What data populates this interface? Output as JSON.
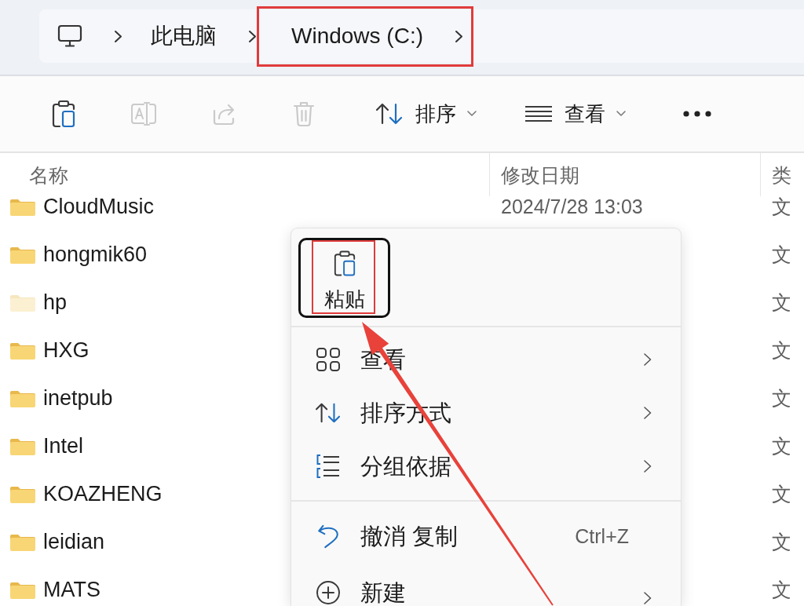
{
  "breadcrumb": {
    "items": [
      {
        "label": "此电脑",
        "highlighted": false
      },
      {
        "label": "Windows (C:)",
        "highlighted": true
      }
    ]
  },
  "toolbar": {
    "actions": [
      {
        "kind": "paste",
        "disabled": false
      },
      {
        "kind": "rename",
        "disabled": true
      },
      {
        "kind": "share",
        "disabled": true
      },
      {
        "kind": "delete",
        "disabled": true
      }
    ],
    "menus": [
      {
        "kind": "sort",
        "label": "排序"
      },
      {
        "kind": "view",
        "label": "查看"
      }
    ]
  },
  "file_list": {
    "columns": [
      {
        "label": "名称"
      },
      {
        "label": "修改日期"
      },
      {
        "label": "类"
      }
    ],
    "rows": [
      {
        "name": "CloudMusic",
        "modified": "2024/7/28 13:03",
        "type": "文",
        "hidden": false
      },
      {
        "name": "hongmik60",
        "type": "文",
        "hidden": false
      },
      {
        "name": "hp",
        "type": "文",
        "hidden": true
      },
      {
        "name": "HXG",
        "type": "文",
        "hidden": false
      },
      {
        "name": "inetpub",
        "type": "文",
        "hidden": false
      },
      {
        "name": "Intel",
        "type": "文",
        "hidden": false
      },
      {
        "name": "KOAZHENG",
        "type": "文",
        "hidden": false
      },
      {
        "name": "leidian",
        "type": "文",
        "hidden": false
      },
      {
        "name": "MATS",
        "type": "文",
        "hidden": false
      }
    ]
  },
  "context_menu": {
    "paste": {
      "label": "粘贴",
      "focused": true,
      "highlighted": true
    },
    "groups": [
      {
        "items": [
          {
            "kind": "view",
            "label": "查看",
            "submenu": true
          },
          {
            "kind": "sort",
            "label": "排序方式",
            "submenu": true
          },
          {
            "kind": "group",
            "label": "分组依据",
            "submenu": true
          }
        ]
      },
      {
        "items": [
          {
            "kind": "undo",
            "label": "撤消 复制",
            "shortcut": "Ctrl+Z",
            "submenu": false
          },
          {
            "kind": "new",
            "label": "新建",
            "submenu": true
          }
        ]
      }
    ]
  },
  "annotation_arrow": true
}
